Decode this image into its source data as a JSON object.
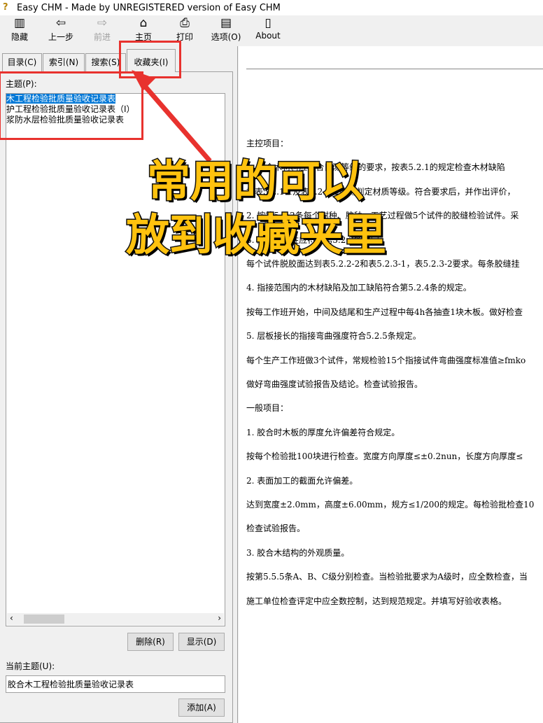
{
  "window": {
    "title": "Easy CHM - Made by UNREGISTERED version of Easy CHM"
  },
  "toolbar": [
    {
      "label": "隐藏",
      "icon": "hide-icon",
      "enabled": true
    },
    {
      "label": "上一步",
      "icon": "back-arrow-icon",
      "enabled": true
    },
    {
      "label": "前进",
      "icon": "forward-arrow-icon",
      "enabled": false
    },
    {
      "label": "主页",
      "icon": "home-icon",
      "enabled": true
    },
    {
      "label": "打印",
      "icon": "printer-icon",
      "enabled": true
    },
    {
      "label": "选项(O)",
      "icon": "options-icon",
      "enabled": true
    },
    {
      "label": "About",
      "icon": "about-icon",
      "enabled": true
    }
  ],
  "tabs": [
    {
      "label": "目录(C)"
    },
    {
      "label": "索引(N)"
    },
    {
      "label": "搜索(S)"
    },
    {
      "label": "收藏夹(I)",
      "active": true
    }
  ],
  "favorites": {
    "topics_label": "主题(P):",
    "items": [
      "木工程检验批质量验收记录表",
      "护工程检验批质量验收记录表（Ⅰ）",
      "浆防水层检验批质量验收记录表"
    ],
    "selected_index": 0,
    "delete_label": "删除(R)",
    "show_label": "显示(D)",
    "current_topic_label": "当前主题(U):",
    "current_topic_value": "胶合木工程检验批质量验收记录表",
    "add_label": "添加(A)"
  },
  "content": {
    "lines": [
      "主控项目：",
      "1. 胶合木材料应符合目测等级的要求，按表5.2.1的规定检查木材缺陷",
      "按表5.2.1-1及表5.2.1-2目测判定材质等级。符合要求后，并作出评价，",
      "2. 按第5.2.2条每个树种、胶种、工艺过程做5个试件的胶缝检验试件。采",
      "3. 胶缝完整性应符合第5.2.3条规定。",
      "每个试件脱胶面达到表5.2.2-2和表5.2.3-1，表5.2.3-2要求。每条胶缝挂",
      "4. 指接范围内的木材缺陷及加工缺陷符合第5.2.4条的规定。",
      "按每工作班开始，中间及结尾和生产过程中每4h各抽查1块木板。做好检查",
      "5. 层板接长的指接弯曲强度符合5.2.5条规定。",
      "每个生产工作班做3个试件，常规检验15个指接试件弯曲强度标准值≥fmko",
      "做好弯曲强度试验报告及结论。检查试验报告。",
      "一般项目：",
      "1. 胶合时木板的厚度允许偏差符合规定。",
      "按每个检验批100块进行检查。宽度方向厚度≤±0.2nun，长度方向厚度≤",
      "2. 表面加工的截面允许偏差。",
      "达到宽度±2.0mm，高度±6.00mm，规方≤1/200的规定。每检验批检查10",
      "检查试验报告。",
      "3. 胶合木结构的外观质量。",
      "按第5.5.5条A、B、C级分别检查。当检验批要求为A级时，应全数检查，当",
      "施工单位检查评定中应全数控制，达到规范规定。并填写好验收表格。"
    ]
  },
  "overlay": {
    "line1": "常用的可以",
    "line2": "放到收藏夹里",
    "colors": {
      "text": "#ffc20e",
      "annotation": "#e8322e"
    }
  }
}
